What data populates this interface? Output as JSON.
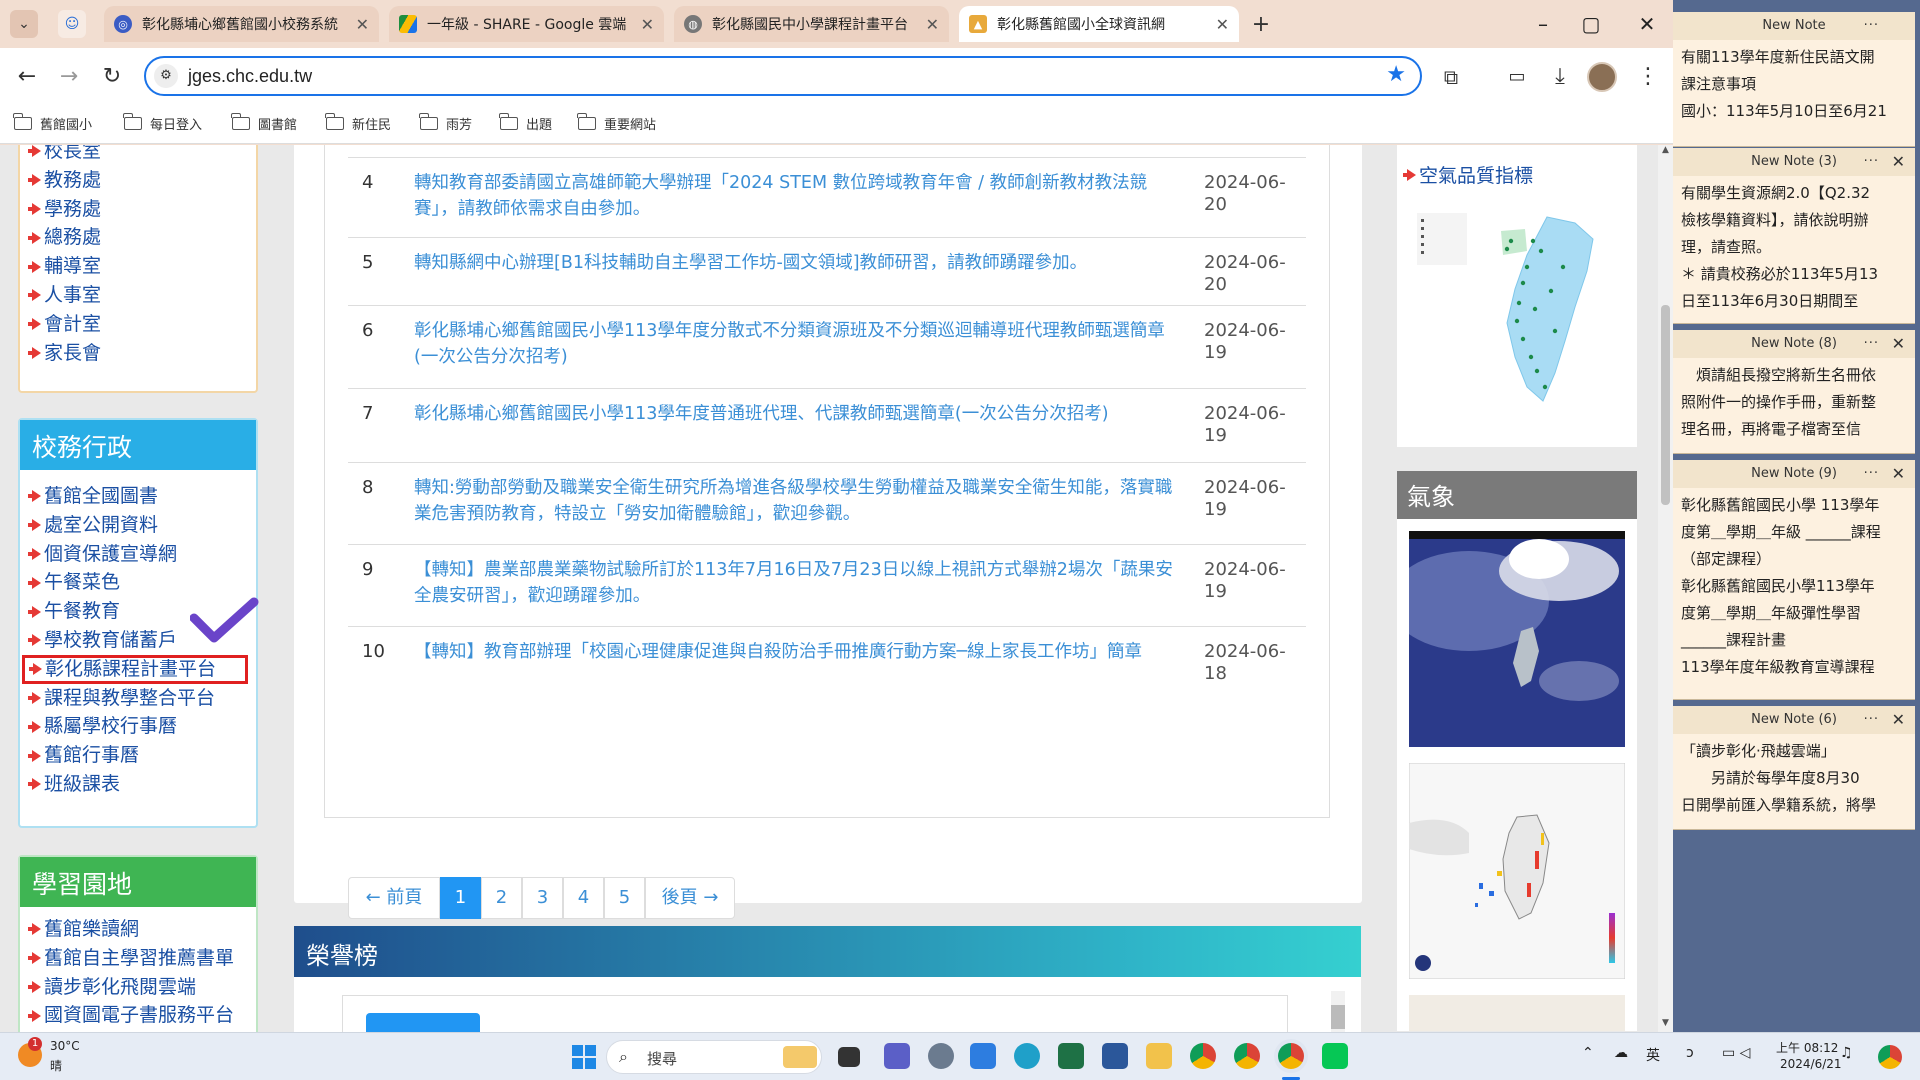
{
  "browser": {
    "tabs": [
      {
        "title": "彰化縣埔心鄉舊館國小校務系統",
        "icon": "school-site-icon",
        "active": false
      },
      {
        "title": "一年級 - SHARE - Google 雲端",
        "icon": "google-drive-icon",
        "active": false
      },
      {
        "title": "彰化縣國民中小學課程計畫平台",
        "icon": "globe-icon",
        "active": false
      },
      {
        "title": "彰化縣舊館國小全球資訊網",
        "icon": "school-site-icon",
        "active": true
      }
    ],
    "url": "jges.chc.edu.tw",
    "bookmarks": [
      "舊館國小",
      "每日登入",
      "圖書館",
      "新住民",
      "雨芳",
      "出題",
      "重要網站"
    ]
  },
  "left_sidebar": {
    "top_links": [
      "校長室",
      "教務處",
      "學務處",
      "總務處",
      "輔導室",
      "人事室",
      "會計室",
      "家長會"
    ],
    "admin_panel": {
      "title": "校務行政",
      "links": [
        "舊館全國圖書",
        "處室公開資料",
        "個資保護宣導網",
        "午餐菜色",
        "午餐教育",
        "學校教育儲蓄戶",
        "彰化縣課程計畫平台",
        "課程與教學整合平台",
        "縣屬學校行事曆",
        "舊館行事曆",
        "班級課表"
      ],
      "highlighted_link": "彰化縣課程計畫平台"
    },
    "learning_panel": {
      "title": "學習園地",
      "links": [
        "舊館樂讀網",
        "舊館自主學習推薦書單",
        "讀步彰化飛閱雲端",
        "國資圖電子書服務平台"
      ]
    }
  },
  "news": [
    {
      "num": "4",
      "title": "轉知教育部委請國立高雄師範大學辦理「2024 STEM 數位跨域教育年會 / 教師創新教材教法競賽」，請教師依需求自由參加。",
      "date": "2024-06-20"
    },
    {
      "num": "5",
      "title": "轉知縣網中心辦理[B1科技輔助自主學習工作坊-國文領域]教師研習，請教師踴躍參加。",
      "date": "2024-06-20"
    },
    {
      "num": "6",
      "title": "彰化縣埔心鄉舊館國民小學113學年度分散式不分類資源班及不分類巡迴輔導班代理教師甄選簡章(一次公告分次招考)",
      "date": "2024-06-19"
    },
    {
      "num": "7",
      "title": "彰化縣埔心鄉舊館國民小學113學年度普通班代理、代課教師甄選簡章(一次公告分次招考)",
      "date": "2024-06-19"
    },
    {
      "num": "8",
      "title": "轉知:勞動部勞動及職業安全衛生研究所為增進各級學校學生勞動權益及職業安全衛生知能，落實職業危害預防教育，特設立「勞安加衛體驗館」，歡迎參觀。",
      "date": "2024-06-19"
    },
    {
      "num": "9",
      "title": "【轉知】農業部農業藥物試驗所訂於113年7月16日及7月23日以線上視訊方式舉辦2場次「蔬果安全農安研習」，歡迎踴躍參加。",
      "date": "2024-06-19"
    },
    {
      "num": "10",
      "title": "【轉知】教育部辦理「校園心理健康促進與自殺防治手冊推廣行動方案─線上家長工作坊」簡章",
      "date": "2024-06-18"
    }
  ],
  "pagination": {
    "prev": "← 前頁",
    "pages": [
      "1",
      "2",
      "3",
      "4",
      "5"
    ],
    "current": "1",
    "next": "後頁 →"
  },
  "honor": {
    "title": "榮譽榜"
  },
  "right_sidebar": {
    "air_quality": "空氣品質指標",
    "weather": "氣象"
  },
  "sticky_notes": [
    {
      "title": "New Note",
      "lines": [
        "有關113學年度新住民語文開",
        "課注意事項",
        "國小：113年5月10日至6月21"
      ]
    },
    {
      "title": "New Note (3)",
      "lines": [
        "有關學生資源網2.0【Q2.32",
        "檢核學籍資料】，請依說明辦",
        "理，請查照。",
        "＊ 請貴校務必於113年5月13",
        "日至113年6月30日期間至"
      ]
    },
    {
      "title": "New Note (8)",
      "lines": [
        "　煩請組長撥空將新生名冊依",
        "照附件一的操作手冊，重新整",
        "理名冊，再將電子檔寄至信"
      ]
    },
    {
      "title": "New Note (9)",
      "lines": [
        "彰化縣舊館國民小學 113學年",
        "度第＿學期＿年級 ______課程",
        "（部定課程）",
        "彰化縣舊館國民小學113學年",
        "度第＿學期＿年級彈性學習",
        "______課程計畫",
        "113學年度年級教育宣導課程"
      ]
    },
    {
      "title": "New Note (6)",
      "lines": [
        "「讀步彰化‧飛越雲端」",
        "　　另請於每學年度8月30",
        "日開學前匯入學籍系統，將學"
      ]
    }
  ],
  "taskbar": {
    "weather_temp": "30°C",
    "weather_desc": "晴",
    "search_placeholder": "搜尋",
    "ime": "英",
    "time": "上午 08:12",
    "date": "2024/6/21",
    "notification_count": "1"
  },
  "colors": {
    "admin_head": "#29aee6",
    "learning_head": "#3fb553",
    "honor_head": "#1f4e8c",
    "weather_head": "#7a7a7a",
    "highlight_box": "#e02020",
    "link": "#1a4fa3",
    "news_link": "#3b8fd6"
  }
}
